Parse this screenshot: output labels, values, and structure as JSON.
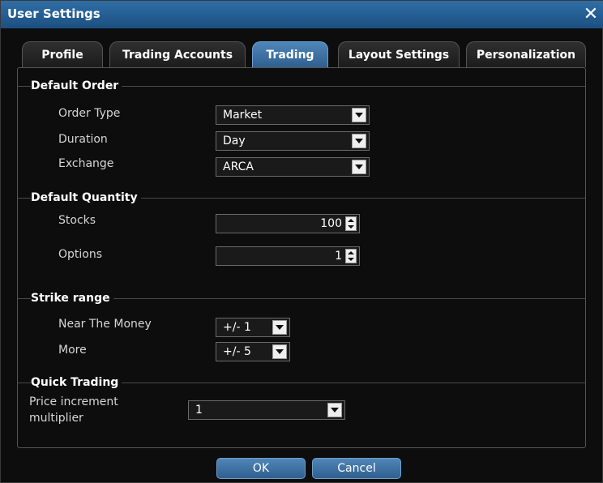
{
  "window": {
    "title": "User Settings",
    "close_glyph": "✕"
  },
  "tabs": [
    {
      "label": "Profile",
      "active": false
    },
    {
      "label": "Trading Accounts",
      "active": false
    },
    {
      "label": "Trading",
      "active": true
    },
    {
      "label": "Layout Settings",
      "active": false
    },
    {
      "label": "Personalization",
      "active": false
    }
  ],
  "default_order": {
    "title": "Default Order",
    "order_type": {
      "label": "Order Type",
      "value": "Market"
    },
    "duration": {
      "label": "Duration",
      "value": "Day"
    },
    "exchange": {
      "label": "Exchange",
      "value": "ARCA"
    }
  },
  "default_quantity": {
    "title": "Default Quantity",
    "stocks": {
      "label": "Stocks",
      "value": "100"
    },
    "options": {
      "label": "Options",
      "value": "1"
    }
  },
  "strike_range": {
    "title": "Strike range",
    "near_the_money": {
      "label": "Near The Money",
      "value": "+/- 1"
    },
    "more": {
      "label": "More",
      "value": "+/- 5"
    }
  },
  "quick_trading": {
    "title": "Quick Trading",
    "price_increment": {
      "label_line1": "Price increment",
      "label_line2": "multiplier",
      "value": "1"
    }
  },
  "buttons": {
    "ok": "OK",
    "cancel": "Cancel"
  },
  "colors": {
    "accent": "#2f6ea6",
    "panel_bg": "#0d0d0d"
  }
}
